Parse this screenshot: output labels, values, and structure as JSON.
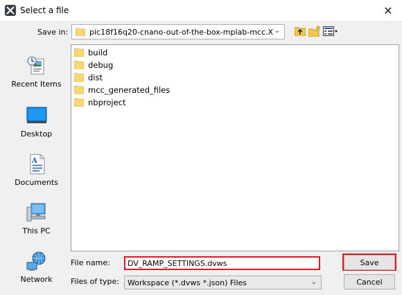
{
  "window": {
    "title": "Select a file",
    "close_glyph": "✕",
    "app_icon": "app-logo-icon"
  },
  "toolbar": {
    "save_in_label": "Save in:",
    "save_in_value": "pic18f16q20-cnano-out-of-the-box-mplab-mcc.X",
    "icons": [
      "up-one-level-icon",
      "create-new-folder-icon",
      "view-menu-icon"
    ]
  },
  "places": [
    {
      "label": "Recent Items",
      "icon": "recent-items-icon"
    },
    {
      "label": "Desktop",
      "icon": "desktop-icon"
    },
    {
      "label": "Documents",
      "icon": "documents-icon"
    },
    {
      "label": "This PC",
      "icon": "this-pc-icon"
    },
    {
      "label": "Network",
      "icon": "network-icon"
    }
  ],
  "files": [
    {
      "name": "build"
    },
    {
      "name": "debug"
    },
    {
      "name": "dist"
    },
    {
      "name": "mcc_generated_files"
    },
    {
      "name": "nbproject"
    }
  ],
  "form": {
    "file_name_label": "File name:",
    "file_name_value": "DV_RAMP_SETTINGS.dvws",
    "file_type_label": "Files of type:",
    "file_type_value": "Workspace (*.dvws *.json) Files"
  },
  "buttons": {
    "save": "Save",
    "cancel": "Cancel"
  },
  "colors": {
    "highlight": "#e3171d",
    "folder": "#f8d775",
    "dialog_bg": "#f0f0f0"
  }
}
